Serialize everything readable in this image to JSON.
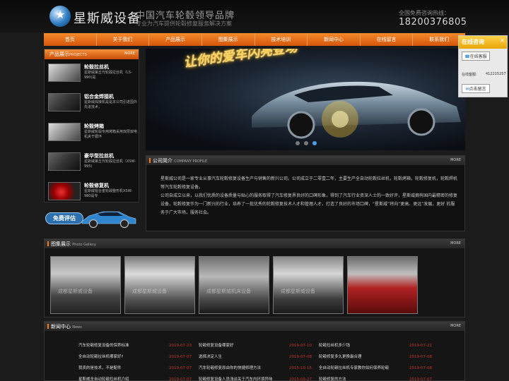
{
  "header": {
    "logo_text": "星斯威设备",
    "slogan_main": "中国汽车轮毂领导品牌",
    "slogan_sub": "专业为汽车提供轮毂修复服务解决方案",
    "hotline_label": "全国免费咨询热线：",
    "hotline_number": "18200376805"
  },
  "nav": {
    "items": [
      "首页",
      "关于我们",
      "产品展示",
      "图集展示",
      "技术培训",
      "新闻中心",
      "在线留言",
      "联系我们"
    ]
  },
  "products": {
    "title": "产品展示",
    "subtitle": "PROJECTS",
    "more": "MORE",
    "items": [
      {
        "title": "轮毂拉丝机",
        "desc": "星斯威第五代轮毂拉丝机（LS-990)是"
      },
      {
        "title": "铝合金焊接机",
        "desc": "星斯威焊接机是是本公司引进国外先进技术，"
      },
      {
        "title": "轮毂烤箱",
        "desc": "星斯威轮毂专用烤箱采用双层双电机夹干循环"
      },
      {
        "title": "豪华型拉丝机",
        "desc": "星斯威第五代轮毂拉丝机（XSW-995)"
      },
      {
        "title": "轮毂修复机",
        "desc": "星斯威铝合金轮毂整形机XSW-980是专"
      }
    ]
  },
  "evaluation": {
    "label": "免费评估"
  },
  "banner": {
    "title": "让你的爱车闪亮登场"
  },
  "chat": {
    "title": "在线咨询",
    "service_label": "在线客服",
    "qq_label": "在线客服:",
    "qq_number": "412215257",
    "message_label": "点击留言"
  },
  "about": {
    "title": "公司简介",
    "subtitle": "COMPANY PROFILE",
    "more": "MORE",
    "para1": "星斯威公司是一家专业从事汽车轮毂修复设备生产与销售的新兴公司。公司成立于二零壹二年，主要生产全自动轮毂拉丝机，轮毂烤箱，轮毂修复机，轮毂焊机等汽车轮毂修复设备。",
    "para2": "公司自成立以来，以我们优质的设备质量与贴心的服务取得了汽车修复界良好的口碑形象，得到了汽车行业资深人士的一致好评，星斯威拥有国内最精密的修复设备，轮毂修复作为一门新兴的行业，培养了一批优秀的轮毂修复技术人才和管理人才，打造了良好的市场口碑，“星斯威”将向“更高、更远”发展，更好 的服务于广大市场，服务社会。"
  },
  "gallery": {
    "title": "图集展示",
    "subtitle": "Photo Gallery",
    "more": "MORE",
    "items": [
      {
        "caption": "成都星斯威设备"
      },
      {
        "caption": "成都星斯威设备"
      },
      {
        "caption": "成都星斯威机床设备"
      },
      {
        "caption": "成都星斯威设备"
      },
      {
        "caption": ""
      }
    ]
  },
  "news": {
    "title": "新闻中心",
    "subtitle": "News",
    "more": "MORE",
    "columns": [
      [
        {
          "title": "汽车轮毂修复设备的保养标准",
          "date": "2019-07-23"
        },
        {
          "title": "全自动轮毂拉丝机哪家好?",
          "date": "2019-07-07"
        },
        {
          "title": "我卖的是技术，不是配件",
          "date": "2019-07-07"
        },
        {
          "title": "星斯威全自动轮毂拉丝机介绍",
          "date": "2019-07-07"
        }
      ],
      [
        {
          "title": "轮毂修复设备哪家好",
          "date": "2019-07-10"
        },
        {
          "title": "选择决定人生",
          "date": "2019-07-08"
        },
        {
          "title": "汽车轮毂修复原由你的快捷修理方法",
          "date": "2015-10-15"
        },
        {
          "title": "轮毂修复设备人员浅谈关于汽车内环境异味",
          "date": "2015-09-27"
        }
      ],
      [
        {
          "title": "轮毂拉丝机多少钱",
          "date": "2019-07-21"
        },
        {
          "title": "轮毂修复多久更换最合理",
          "date": "2019-07-08"
        },
        {
          "title": "全自动轮毂拉丝机专家教你如何保养轮毂",
          "date": "2019-07-08"
        },
        {
          "title": "轮毂修复的方法",
          "date": "2019-07-07"
        }
      ]
    ]
  }
}
